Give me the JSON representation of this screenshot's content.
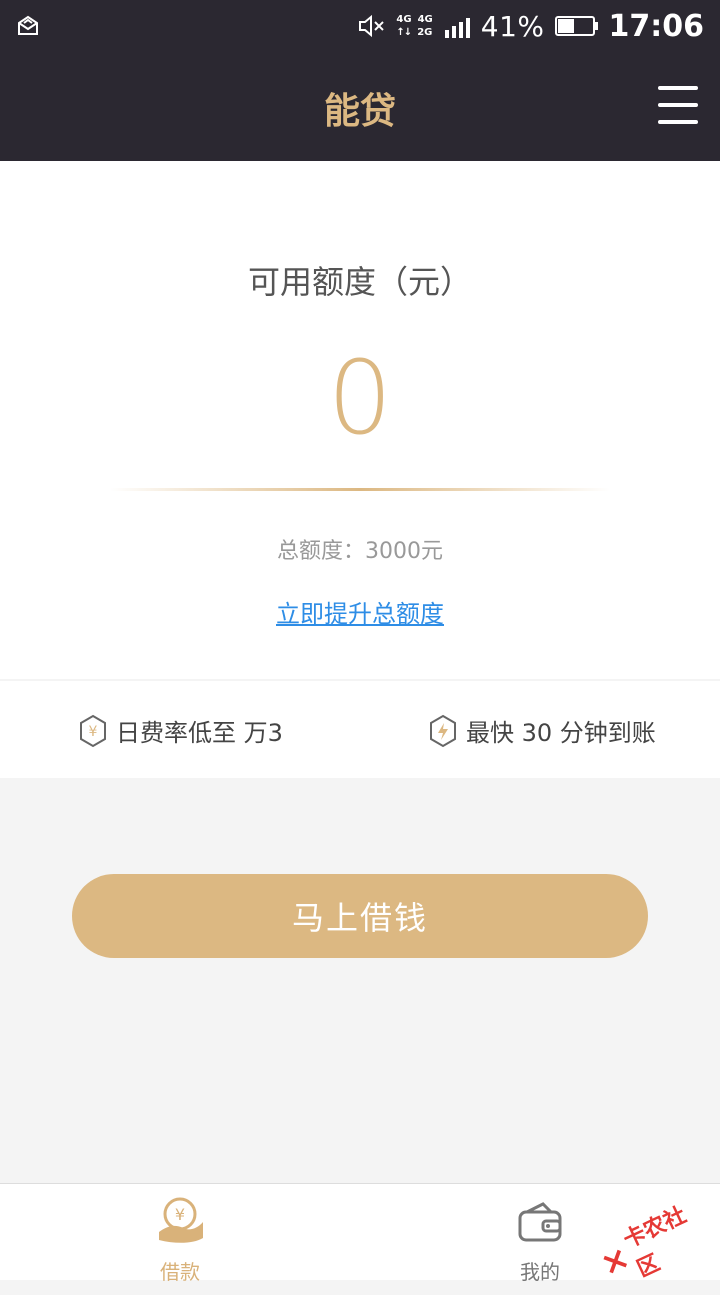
{
  "statusbar": {
    "signal_mini_1": "4G",
    "signal_mini_2": "4G",
    "signal_mini_3": "2G",
    "battery_percent": "41%",
    "time": "17:06"
  },
  "nav": {
    "title": "能贷"
  },
  "credit": {
    "label": "可用额度（元）",
    "available_amount": "0",
    "total_line": "总额度：3000元",
    "raise_link": "立即提升总额度"
  },
  "features": [
    {
      "icon": "yen-hexagon-icon",
      "text": "日费率低至 万3"
    },
    {
      "icon": "lightning-hexagon-icon",
      "text": "最快 30 分钟到账"
    }
  ],
  "cta": {
    "label": "马上借钱"
  },
  "tabs": [
    {
      "label": "借款",
      "active": true,
      "icon": "yen-hand-icon"
    },
    {
      "label": "我的",
      "active": false,
      "icon": "wallet-icon"
    }
  ],
  "watermark": {
    "text": "卡农社区"
  },
  "colors": {
    "header_bg": "#2b2831",
    "accent_gold": "#dcb882",
    "link_blue": "#2e8de6",
    "watermark_red": "#e53935"
  }
}
